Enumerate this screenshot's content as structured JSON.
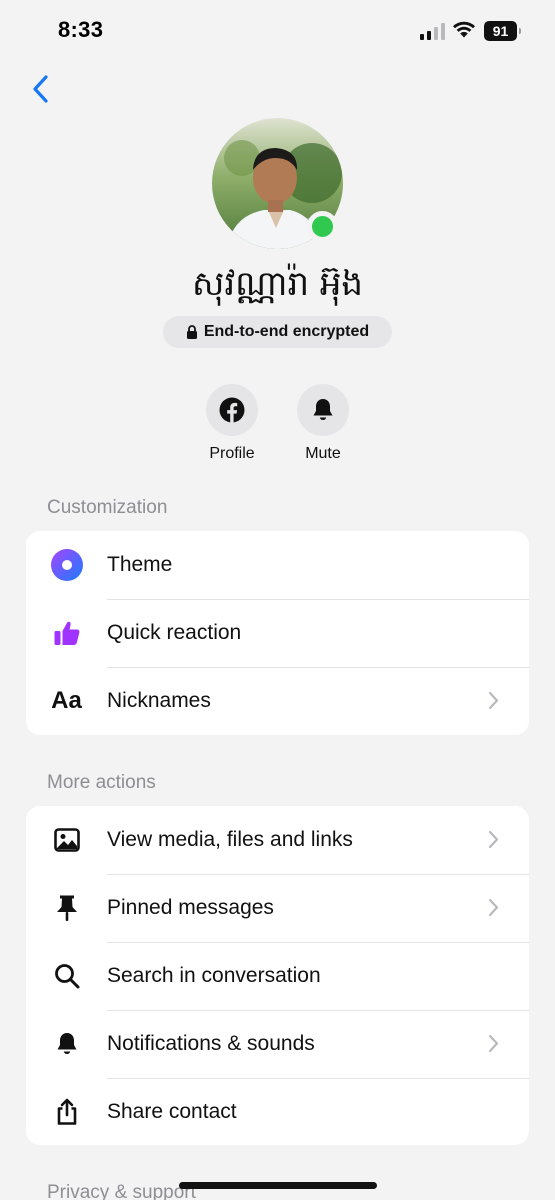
{
  "status_bar": {
    "time": "8:33",
    "battery": "91"
  },
  "header": {
    "back_icon": "chevron-left-icon",
    "contact_name": "សុវណ្ណារ៉ា អ៊ុង",
    "encryption_label": "End-to-end encrypted",
    "online": true
  },
  "actions": [
    {
      "label": "Profile",
      "icon": "facebook-icon"
    },
    {
      "label": "Mute",
      "icon": "bell-icon"
    }
  ],
  "customization": {
    "title": "Customization",
    "items": [
      {
        "label": "Theme",
        "icon": "theme-icon",
        "chevron": false
      },
      {
        "label": "Quick reaction",
        "icon": "thumbs-up-icon",
        "chevron": false
      },
      {
        "label": "Nicknames",
        "icon": "aa-text-icon",
        "icon_text": "Aa",
        "chevron": true
      }
    ]
  },
  "more_actions": {
    "title": "More actions",
    "items": [
      {
        "label": "View media, files and links",
        "icon": "image-icon",
        "chevron": true
      },
      {
        "label": "Pinned messages",
        "icon": "pin-icon",
        "chevron": true
      },
      {
        "label": "Search in conversation",
        "icon": "search-icon",
        "chevron": false
      },
      {
        "label": "Notifications & sounds",
        "icon": "bell-icon",
        "chevron": true
      },
      {
        "label": "Share contact",
        "icon": "share-icon",
        "chevron": false
      }
    ]
  },
  "privacy": {
    "title": "Privacy & support"
  },
  "colors": {
    "accent": "#1877f2",
    "online": "#31c84f",
    "quick_reaction": "#a033ff",
    "theme_gradient": [
      "#a445ff",
      "#1e7bff"
    ]
  }
}
